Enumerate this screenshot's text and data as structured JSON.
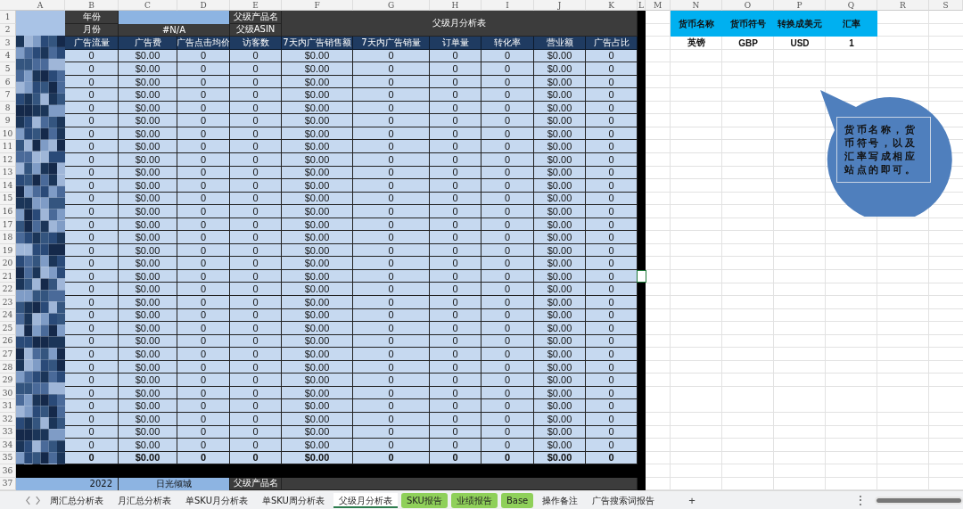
{
  "column_letters": [
    "A",
    "B",
    "C",
    "D",
    "E",
    "F",
    "G",
    "H",
    "I",
    "J",
    "K",
    "L",
    "M",
    "N",
    "O",
    "P",
    "Q",
    "R",
    "S"
  ],
  "row_numbers": [
    "1",
    "2",
    "3",
    "4",
    "5",
    "6",
    "7",
    "8",
    "9",
    "10",
    "11",
    "12",
    "13",
    "14",
    "15",
    "16",
    "17",
    "18",
    "19",
    "20",
    "21",
    "22",
    "23",
    "24",
    "25",
    "26",
    "27",
    "28",
    "29",
    "30",
    "31",
    "32",
    "33",
    "34",
    "35",
    "36",
    "37"
  ],
  "header": {
    "year_label": "年份",
    "month_label": "月份",
    "month_value": "#N/A",
    "parent_name_label": "父级产品名",
    "parent_asin_label": "父级ASIN",
    "title": "父级月分析表"
  },
  "columns": [
    "广告流量",
    "广告费",
    "广告点击均价",
    "访客数",
    "7天内广告销售额",
    "7天内广告销量",
    "订单量",
    "转化率",
    "营业额",
    "广告占比"
  ],
  "rows": [
    {
      "values": [
        "0",
        "$0.00",
        "0",
        "0",
        "$0.00",
        "0",
        "0",
        "0",
        "$0.00",
        "0"
      ]
    },
    {
      "values": [
        "0",
        "$0.00",
        "0",
        "0",
        "$0.00",
        "0",
        "0",
        "0",
        "$0.00",
        "0"
      ]
    },
    {
      "values": [
        "0",
        "$0.00",
        "0",
        "0",
        "$0.00",
        "0",
        "0",
        "0",
        "$0.00",
        "0"
      ]
    },
    {
      "values": [
        "0",
        "$0.00",
        "0",
        "0",
        "$0.00",
        "0",
        "0",
        "0",
        "$0.00",
        "0"
      ]
    },
    {
      "values": [
        "0",
        "$0.00",
        "0",
        "0",
        "$0.00",
        "0",
        "0",
        "0",
        "$0.00",
        "0"
      ]
    },
    {
      "values": [
        "0",
        "$0.00",
        "0",
        "0",
        "$0.00",
        "0",
        "0",
        "0",
        "$0.00",
        "0"
      ]
    },
    {
      "values": [
        "0",
        "$0.00",
        "0",
        "0",
        "$0.00",
        "0",
        "0",
        "0",
        "$0.00",
        "0"
      ]
    },
    {
      "values": [
        "0",
        "$0.00",
        "0",
        "0",
        "$0.00",
        "0",
        "0",
        "0",
        "$0.00",
        "0"
      ]
    },
    {
      "values": [
        "0",
        "$0.00",
        "0",
        "0",
        "$0.00",
        "0",
        "0",
        "0",
        "$0.00",
        "0"
      ]
    },
    {
      "values": [
        "0",
        "$0.00",
        "0",
        "0",
        "$0.00",
        "0",
        "0",
        "0",
        "$0.00",
        "0"
      ]
    },
    {
      "values": [
        "0",
        "$0.00",
        "0",
        "0",
        "$0.00",
        "0",
        "0",
        "0",
        "$0.00",
        "0"
      ]
    },
    {
      "values": [
        "0",
        "$0.00",
        "0",
        "0",
        "$0.00",
        "0",
        "0",
        "0",
        "$0.00",
        "0"
      ]
    },
    {
      "values": [
        "0",
        "$0.00",
        "0",
        "0",
        "$0.00",
        "0",
        "0",
        "0",
        "$0.00",
        "0"
      ]
    },
    {
      "values": [
        "0",
        "$0.00",
        "0",
        "0",
        "$0.00",
        "0",
        "0",
        "0",
        "$0.00",
        "0"
      ]
    },
    {
      "values": [
        "0",
        "$0.00",
        "0",
        "0",
        "$0.00",
        "0",
        "0",
        "0",
        "$0.00",
        "0"
      ]
    },
    {
      "values": [
        "0",
        "$0.00",
        "0",
        "0",
        "$0.00",
        "0",
        "0",
        "0",
        "$0.00",
        "0"
      ]
    },
    {
      "values": [
        "0",
        "$0.00",
        "0",
        "0",
        "$0.00",
        "0",
        "0",
        "0",
        "$0.00",
        "0"
      ]
    },
    {
      "values": [
        "0",
        "$0.00",
        "0",
        "0",
        "$0.00",
        "0",
        "0",
        "0",
        "$0.00",
        "0"
      ]
    },
    {
      "values": [
        "0",
        "$0.00",
        "0",
        "0",
        "$0.00",
        "0",
        "0",
        "0",
        "$0.00",
        "0"
      ]
    },
    {
      "values": [
        "0",
        "$0.00",
        "0",
        "0",
        "$0.00",
        "0",
        "0",
        "0",
        "$0.00",
        "0"
      ]
    },
    {
      "values": [
        "0",
        "$0.00",
        "0",
        "0",
        "$0.00",
        "0",
        "0",
        "0",
        "$0.00",
        "0"
      ]
    },
    {
      "values": [
        "0",
        "$0.00",
        "0",
        "0",
        "$0.00",
        "0",
        "0",
        "0",
        "$0.00",
        "0"
      ]
    },
    {
      "values": [
        "0",
        "$0.00",
        "0",
        "0",
        "$0.00",
        "0",
        "0",
        "0",
        "$0.00",
        "0"
      ]
    },
    {
      "values": [
        "0",
        "$0.00",
        "0",
        "0",
        "$0.00",
        "0",
        "0",
        "0",
        "$0.00",
        "0"
      ]
    },
    {
      "values": [
        "0",
        "$0.00",
        "0",
        "0",
        "$0.00",
        "0",
        "0",
        "0",
        "$0.00",
        "0"
      ]
    },
    {
      "values": [
        "0",
        "$0.00",
        "0",
        "0",
        "$0.00",
        "0",
        "0",
        "0",
        "$0.00",
        "0"
      ]
    },
    {
      "values": [
        "0",
        "$0.00",
        "0",
        "0",
        "$0.00",
        "0",
        "0",
        "0",
        "$0.00",
        "0"
      ]
    },
    {
      "values": [
        "0",
        "$0.00",
        "0",
        "0",
        "$0.00",
        "0",
        "0",
        "0",
        "$0.00",
        "0"
      ]
    },
    {
      "values": [
        "0",
        "$0.00",
        "0",
        "0",
        "$0.00",
        "0",
        "0",
        "0",
        "$0.00",
        "0"
      ]
    },
    {
      "values": [
        "0",
        "$0.00",
        "0",
        "0",
        "$0.00",
        "0",
        "0",
        "0",
        "$0.00",
        "0"
      ]
    },
    {
      "values": [
        "0",
        "$0.00",
        "0",
        "0",
        "$0.00",
        "0",
        "0",
        "0",
        "$0.00",
        "0"
      ]
    }
  ],
  "total": {
    "values": [
      "0",
      "$0.00",
      "0",
      "0",
      "$0.00",
      "0",
      "0",
      "0",
      "$0.00",
      "0"
    ]
  },
  "next_block": {
    "year": "2022",
    "name": "日光倾城",
    "parent_name_label": "父级产品名"
  },
  "currency_table": {
    "columns": [
      "货币名称",
      "货币符号",
      "转换成美元",
      "汇率"
    ],
    "rows": [
      [
        "英镑",
        "GBP",
        "USD",
        "1"
      ]
    ]
  },
  "callout": {
    "text": "货币名称，货币符号，以及汇率写成相应站点的即可。"
  },
  "sheet_tabs": [
    {
      "label": "周汇总分析表",
      "selected": false,
      "color": "#f0f1f3"
    },
    {
      "label": "月汇总分析表",
      "selected": false,
      "color": "#f0f1f3"
    },
    {
      "label": "单SKU月分析表",
      "selected": false,
      "color": "#f0f1f3"
    },
    {
      "label": "单SKU周分析表",
      "selected": false,
      "color": "#f0f1f3"
    },
    {
      "label": "父级月分析表",
      "selected": true,
      "color": "#ffffff"
    },
    {
      "label": "SKU报告",
      "selected": false,
      "color": "#8fd05a"
    },
    {
      "label": "业绩报告",
      "selected": false,
      "color": "#8fd05a"
    },
    {
      "label": "Base",
      "selected": false,
      "color": "#8fd05a"
    },
    {
      "label": "操作备注",
      "selected": false,
      "color": "#f0f1f3"
    },
    {
      "label": "广告搜索词报告",
      "selected": false,
      "color": "#f0f1f3"
    }
  ],
  "add_sheet": "+",
  "more_menu": "⋮"
}
